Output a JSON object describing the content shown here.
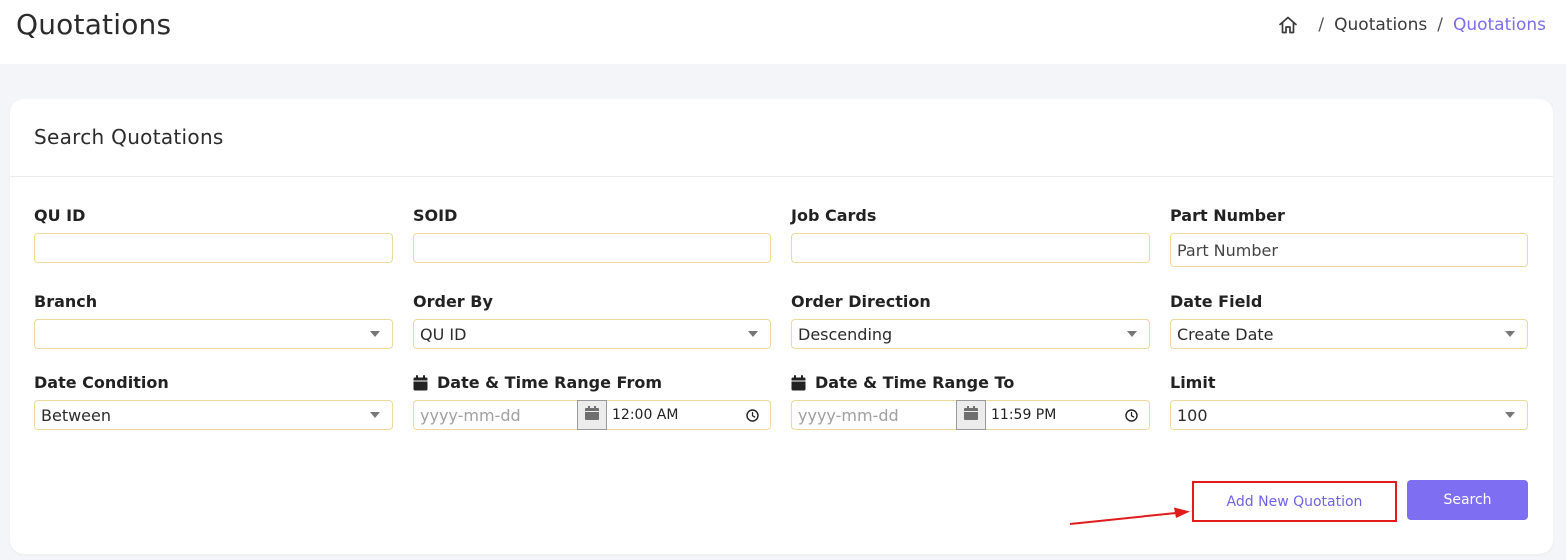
{
  "header": {
    "title": "Quotations",
    "breadcrumb": [
      "Quotations",
      "Quotations"
    ],
    "breadcrumb_separator": "/",
    "home_icon": "home-icon"
  },
  "search_card": {
    "title": "Search Quotations",
    "fields": {
      "qu_id": {
        "label": "QU ID",
        "value": ""
      },
      "soid": {
        "label": "SOID",
        "value": ""
      },
      "job_cards": {
        "label": "Job Cards",
        "value": ""
      },
      "part_number": {
        "label": "Part Number",
        "placeholder": "Part Number",
        "value": ""
      },
      "branch": {
        "label": "Branch",
        "selected": ""
      },
      "order_by": {
        "label": "Order By",
        "selected": "QU ID"
      },
      "order_direction": {
        "label": "Order Direction",
        "selected": "Descending"
      },
      "date_field": {
        "label": "Date Field",
        "selected": "Create Date"
      },
      "date_condition": {
        "label": "Date Condition",
        "selected": "Between"
      },
      "range_from": {
        "label": "Date & Time Range From",
        "date_placeholder": "yyyy-mm-dd",
        "time": "12:00 AM"
      },
      "range_to": {
        "label": "Date & Time Range To",
        "date_placeholder": "yyyy-mm-dd",
        "time": "11:59 PM"
      },
      "limit": {
        "label": "Limit",
        "selected": "100"
      }
    },
    "buttons": {
      "add_new": "Add New Quotation",
      "search": "Search"
    }
  },
  "colors": {
    "accent": "#7d6ef2",
    "field_border": "#f0d89a",
    "highlight": "#e11b1b"
  }
}
